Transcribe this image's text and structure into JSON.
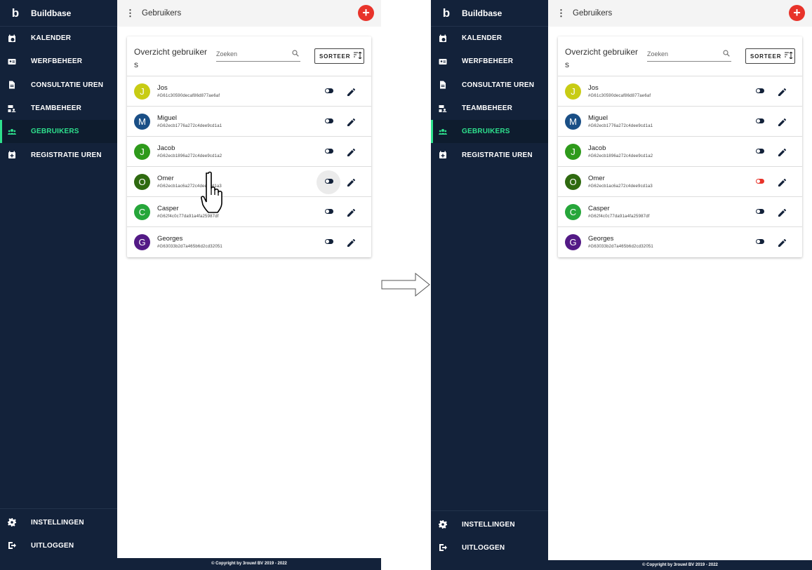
{
  "app": {
    "logo_letter": "b",
    "name": "Buildbase"
  },
  "sidebar": {
    "items": [
      {
        "label": "KALENDER",
        "icon": "calendar-clock-icon"
      },
      {
        "label": "WERFBEHEER",
        "icon": "id-card-icon"
      },
      {
        "label": "CONSULTATIE UREN",
        "icon": "document-icon"
      },
      {
        "label": "TEAMBEHEER",
        "icon": "team-icon"
      },
      {
        "label": "GEBRUIKERS",
        "icon": "users-icon",
        "active": true
      },
      {
        "label": "REGISTRATIE UREN",
        "icon": "calendar-plus-icon"
      }
    ],
    "bottom_items": [
      {
        "label": "INSTELLINGEN",
        "icon": "gear-icon"
      },
      {
        "label": "UITLOGGEN",
        "icon": "logout-icon"
      }
    ]
  },
  "header": {
    "menu_icon": "more-vert-icon",
    "title": "Gebruikers",
    "add_icon": "+"
  },
  "card": {
    "title": "Overzicht gebruiker s",
    "search_placeholder": "Zoeken",
    "sort_label": "SORTEER"
  },
  "users": [
    {
      "initial": "J",
      "name": "Jos",
      "id": "#G61c30590decaf86d877ae6af",
      "color": "#c8cc14"
    },
    {
      "initial": "M",
      "name": "Miguel",
      "id": "#G62ecb1776a272c4dee9cd1a1",
      "color": "#1a4f86"
    },
    {
      "initial": "J",
      "name": "Jacob",
      "id": "#G62ecb1896a272c4dee9cd1a2",
      "color": "#2e9a1b"
    },
    {
      "initial": "O",
      "name": "Omer",
      "id": "#G62ecb1ac6a272c4dee9cd1a3",
      "color": "#2f6a10"
    },
    {
      "initial": "C",
      "name": "Casper",
      "id": "#G62f4c0c77da91a4fa25987df",
      "color": "#26a63a"
    },
    {
      "initial": "G",
      "name": "Georges",
      "id": "#G63033b2d7a465b6d2cd32051",
      "color": "#531a86"
    }
  ],
  "footer": "© Copyright by 3rouwl BV 2019 - 2022",
  "state_after": {
    "omer_active": false
  },
  "colors": {
    "sidebar_bg": "#13223a",
    "active": "#2ee08d",
    "fab": "#e8332a"
  }
}
